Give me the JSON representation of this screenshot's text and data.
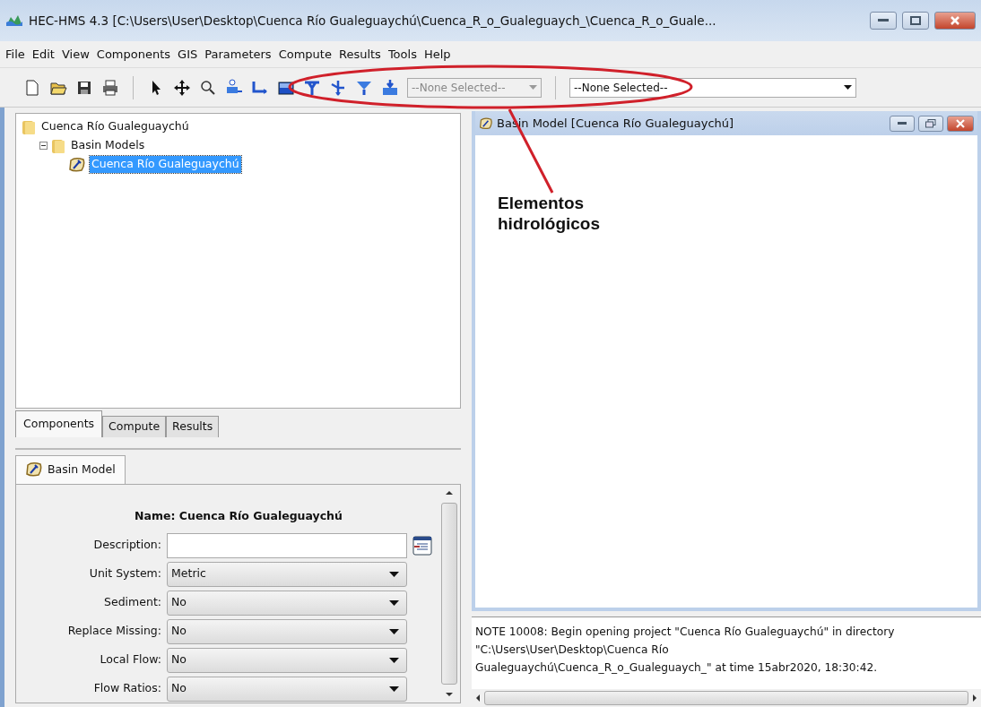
{
  "window": {
    "title": "HEC-HMS 4.3 [C:\\Users\\User\\Desktop\\Cuenca Río Gualeguaychú\\Cuenca_R_o_Gualeguaych_\\Cuenca_R_o_Guale..."
  },
  "menu": [
    "File",
    "Edit",
    "View",
    "Components",
    "GIS",
    "Parameters",
    "Compute",
    "Results",
    "Tools",
    "Help"
  ],
  "toolbar_selects": [
    {
      "value": "--None Selected--",
      "disabled": true
    },
    {
      "value": "--None Selected--",
      "disabled": false
    }
  ],
  "tree": [
    {
      "label": "Cuenca Río Gualeguaychú",
      "kind": "folder",
      "selected": false,
      "children": [
        {
          "label": "Basin Models",
          "kind": "folder",
          "selected": false,
          "expanded": true,
          "children": [
            {
              "label": "Cuenca Río Gualeguaychú",
              "kind": "basin",
              "selected": true
            }
          ]
        }
      ]
    }
  ],
  "tabs": [
    {
      "label": "Components",
      "selected": true
    },
    {
      "label": "Compute",
      "selected": false
    },
    {
      "label": "Results",
      "selected": false
    }
  ],
  "editor": {
    "tab": "Basin Model",
    "name": "Name: Cuenca Río Gualeguaychú",
    "fields": [
      {
        "label": "Description:",
        "kind": "text"
      },
      {
        "label": "Unit System:",
        "kind": "select",
        "value": "Metric"
      },
      {
        "label": "Sediment:",
        "kind": "select",
        "value": "No"
      },
      {
        "label": "Replace Missing:",
        "kind": "select",
        "value": "No"
      },
      {
        "label": "Local Flow:",
        "kind": "select",
        "value": "No"
      },
      {
        "label": "Flow Ratios:",
        "kind": "select",
        "value": "No"
      }
    ]
  },
  "basin_window": {
    "title": "Basin Model [Cuenca Río Gualeguaychú]"
  },
  "log": [
    "NOTE 10008:  Begin opening project \"Cuenca Río Gualeguaychú\" in directory",
    "\"C:\\Users\\User\\Desktop\\Cuenca Río",
    "Gualeguaychú\\Cuenca_R_o_Gualeguaych_\" at time 15abr2020, 18:30:42."
  ],
  "annotation": {
    "text": "Elementos hidrológicos"
  }
}
